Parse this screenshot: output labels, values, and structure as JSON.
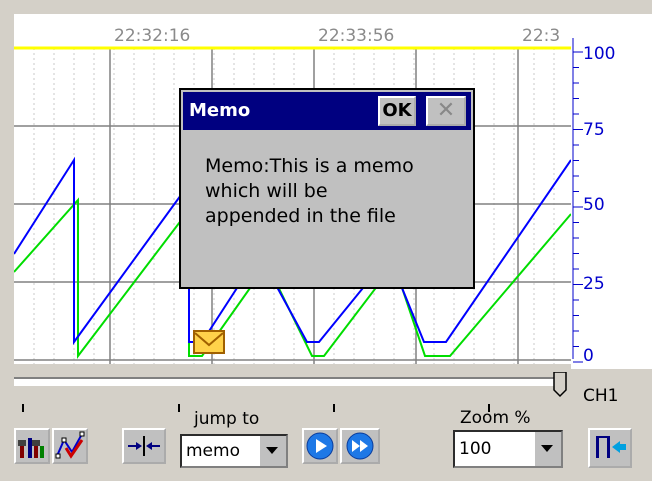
{
  "chart": {
    "time_labels": [
      "22:32:16",
      "22:33:56",
      "22:3"
    ],
    "y_scale_labels": [
      "100",
      "75",
      "50",
      "25",
      "0"
    ],
    "colors": {
      "trace_blue": "#0000ff",
      "trace_green": "#00dd00",
      "limit_line": "#ffff00",
      "grid": "#808080"
    }
  },
  "memo_dialog": {
    "title": "Memo",
    "ok_label": "OK",
    "close_icon": "close-icon",
    "text_lines": [
      "Memo:This is a memo",
      "which will be",
      "appended in the file"
    ]
  },
  "channel_label": "CH1",
  "toolbar": {
    "jump_to_label": "jump to",
    "jump_to_value": "memo",
    "zoom_label": "Zoom %",
    "zoom_value": "100",
    "icons": [
      "settings-tools-icon",
      "trend-line-icon",
      "compress-icon",
      "play-icon",
      "fast-forward-icon",
      "exit-icon"
    ]
  }
}
